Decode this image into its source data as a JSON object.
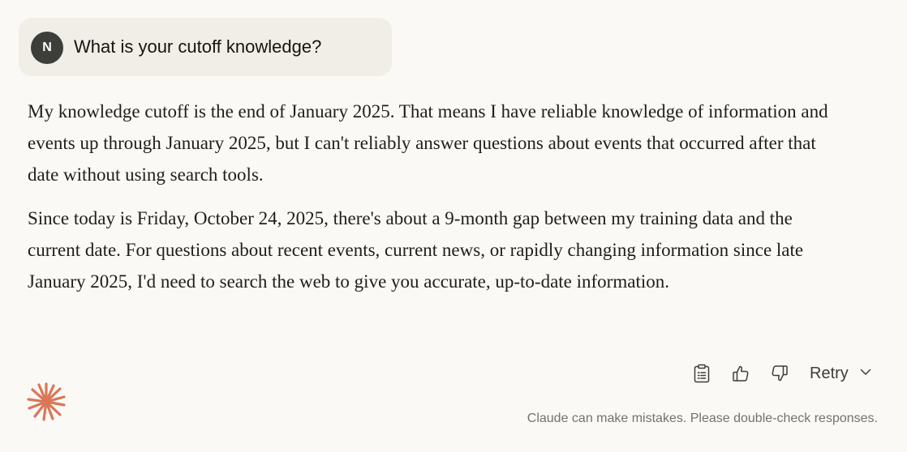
{
  "user_message": {
    "avatar_initial": "N",
    "text": "What is your cutoff knowledge?"
  },
  "assistant_message": {
    "paragraphs": [
      "My knowledge cutoff is the end of January 2025. That means I have reliable knowledge of information and events up through January 2025, but I can't reliably answer questions about events that occurred after that date without using search tools.",
      "Since today is Friday, October 24, 2025, there's about a 9-month gap between my training data and the current date. For questions about recent events, current news, or rapidly changing information since late January 2025, I'd need to search the web to give you accurate, up-to-date information."
    ]
  },
  "actions": {
    "icons": [
      "clipboard-icon",
      "thumbs-up-icon",
      "thumbs-down-icon",
      "chevron-down-icon"
    ],
    "retry_label": "Retry"
  },
  "footer": {
    "disclaimer": "Claude can make mistakes. Please double-check responses."
  },
  "colors": {
    "background": "#FAF9F5",
    "user_bubble": "#F0EEE6",
    "avatar": "#3D3D3A",
    "brand_accent": "#D97757",
    "disclaimer_text": "#73726C"
  }
}
